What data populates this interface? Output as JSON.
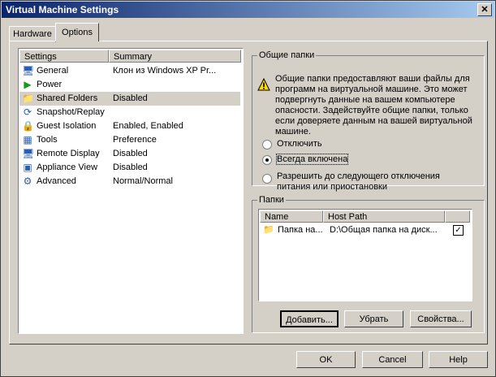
{
  "window": {
    "title": "Virtual Machine Settings",
    "close_glyph": "✕"
  },
  "tabs": [
    {
      "label": "Hardware"
    },
    {
      "label": "Options"
    }
  ],
  "settings": {
    "headers": {
      "settings": "Settings",
      "summary": "Summary"
    },
    "rows": [
      {
        "icon": "general-icon",
        "glyph": "🖥",
        "label": "General",
        "summary": "Клон из Windows XP Pr..."
      },
      {
        "icon": "power-icon",
        "glyph": "▶",
        "label": "Power",
        "summary": ""
      },
      {
        "icon": "folder-icon",
        "glyph": "📁",
        "label": "Shared Folders",
        "summary": "Disabled"
      },
      {
        "icon": "snapshot-icon",
        "glyph": "⟳",
        "label": "Snapshot/Replay",
        "summary": ""
      },
      {
        "icon": "lock-icon",
        "glyph": "🔒",
        "label": "Guest Isolation",
        "summary": "Enabled, Enabled"
      },
      {
        "icon": "tools-icon",
        "glyph": "▦",
        "label": "Tools",
        "summary": "Preference"
      },
      {
        "icon": "display-icon",
        "glyph": "🖥",
        "label": "Remote Display",
        "summary": "Disabled"
      },
      {
        "icon": "appliance-icon",
        "glyph": "▣",
        "label": "Appliance View",
        "summary": "Disabled"
      },
      {
        "icon": "advanced-icon",
        "glyph": "⚙",
        "label": "Advanced",
        "summary": "Normal/Normal"
      }
    ]
  },
  "shared_folders": {
    "legend": "Общие папки",
    "warning": "Общие папки предоставляют ваши файлы для программ на виртуальной машине. Это может подвергнуть данные на вашем компьютере опасности. Задействуйте общие папки, только если доверяете данным на вашей виртуальной машине.",
    "options": [
      {
        "label": "Отключить"
      },
      {
        "label": "Всегда включена"
      },
      {
        "label": "Разрешить до следующего отключения питания или приостановки"
      }
    ]
  },
  "folders": {
    "legend": "Папки",
    "headers": {
      "name": "Name",
      "host_path": "Host Path"
    },
    "rows": [
      {
        "name": "Папка на...",
        "host_path": "D:\\Общая папка на диск...",
        "checked_glyph": "✓"
      }
    ],
    "buttons": {
      "add": "Добавить...",
      "remove": "Убрать",
      "properties": "Свойства..."
    }
  },
  "footer": {
    "ok": "OK",
    "cancel": "Cancel",
    "help": "Help"
  }
}
